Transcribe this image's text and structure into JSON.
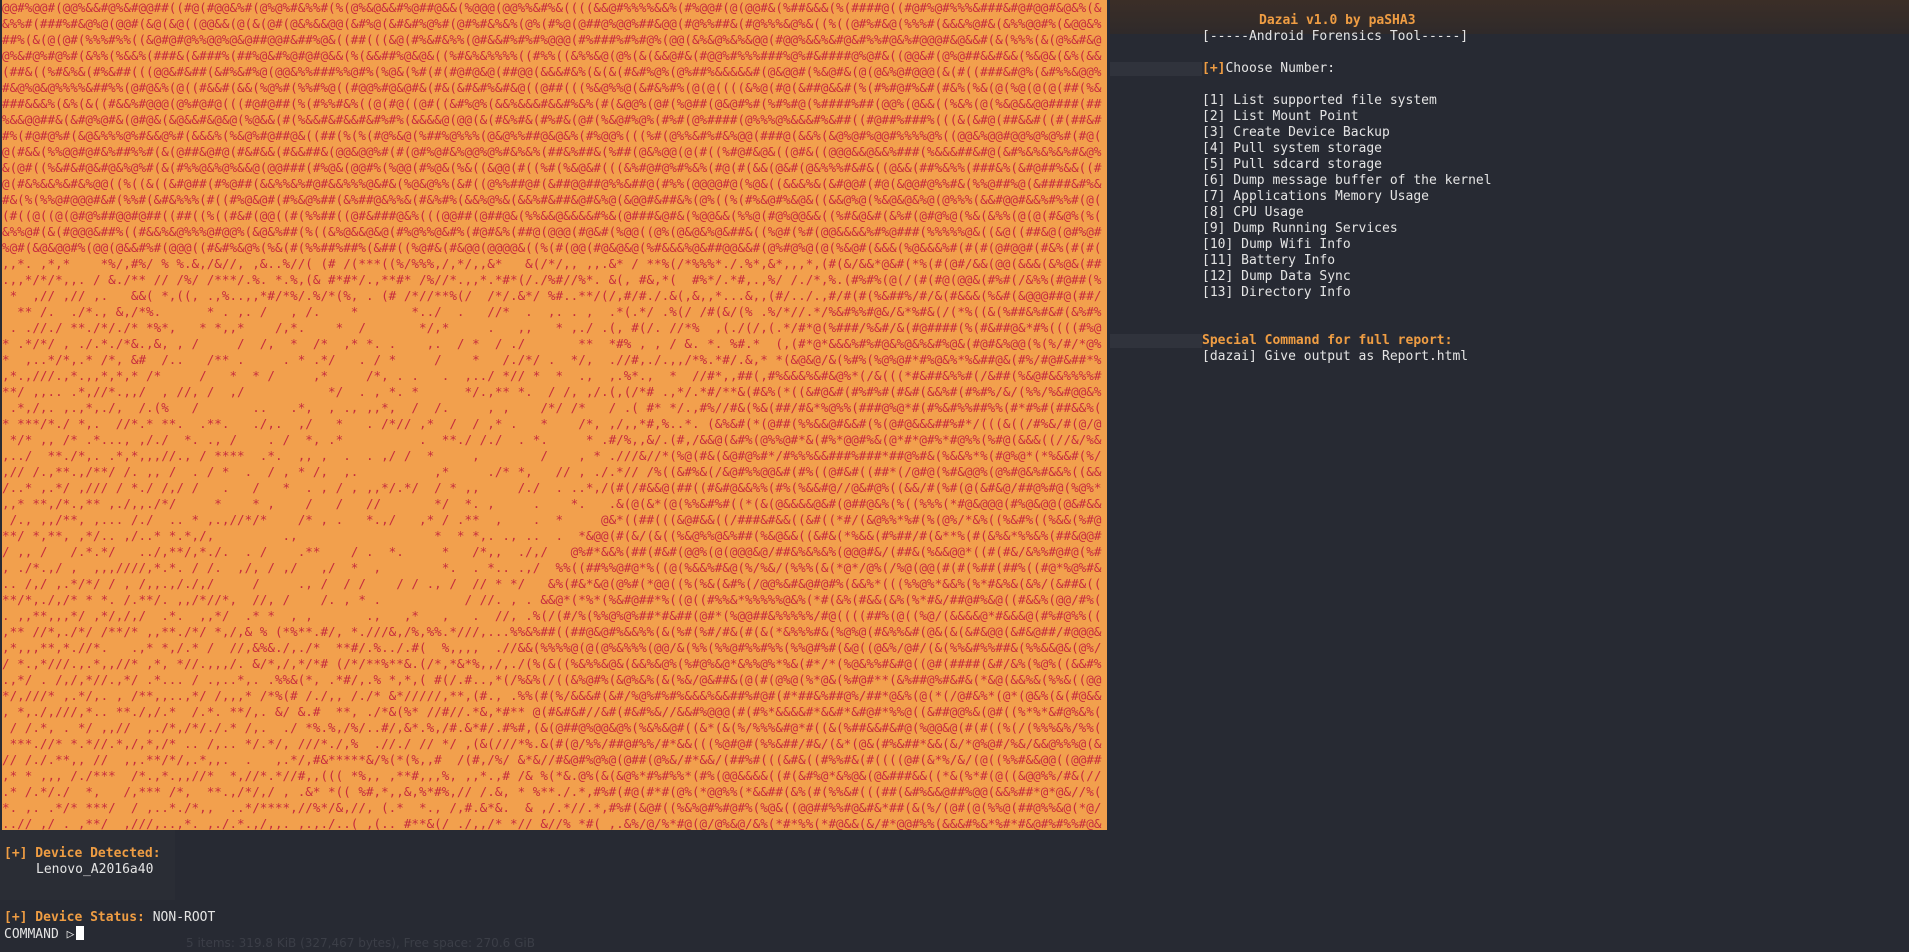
{
  "art": {
    "description_colors": {
      "background": "#f2a04d",
      "glyphs": "#c62b3e"
    }
  },
  "header": {
    "title": "Dazai v1.0 by paSHA3",
    "subtitle": "[-----Android Forensics Tool-----]"
  },
  "menu": {
    "prompt_tag": "[+]",
    "prompt_text": "Choose Number:",
    "items": [
      "[1] List supported file system",
      "[2] List Mount Point",
      "[3] Create Device Backup",
      "[4] Pull system storage",
      "[5] Pull sdcard storage",
      "[6] Dump message buffer of the kernel",
      "[7] Applications Memory Usage",
      "[8] CPU Usage",
      "[9] Dump Running Services",
      "[10] Dump Wifi Info",
      "[11] Battery Info",
      "[12] Dump Data Sync",
      "[13] Directory Info"
    ]
  },
  "special": {
    "title": "Special Command for full report:",
    "command": "[dazai] Give output as Report.html"
  },
  "device": {
    "detected_label": "[+] Device Detected:",
    "detected_value": "Lenovo_A2016a40",
    "status_label": "[+] Device Status:",
    "status_value": "NON-ROOT"
  },
  "command_line": {
    "prompt": "COMMAND ▷"
  },
  "ghost_status": "5 items: 319.8 KiB (327,467 bytes), Free space: 270.6 GiB",
  "colors": {
    "accent": "#ef9d43",
    "text": "#e4e4e4",
    "background": "#272a33"
  }
}
